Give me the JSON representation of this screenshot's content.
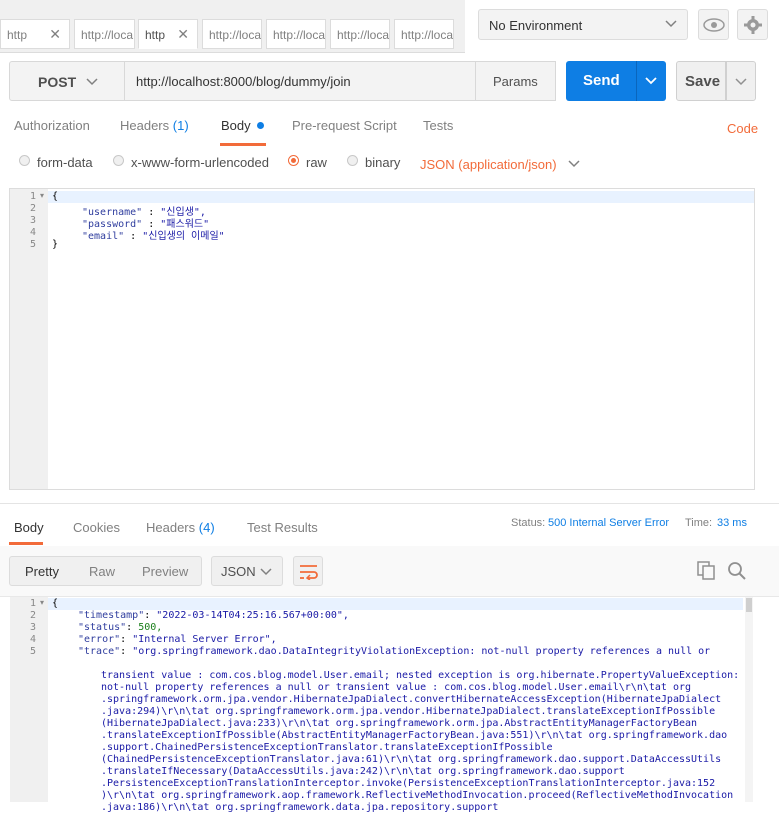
{
  "tabs": [
    {
      "label": "http",
      "active": false,
      "closable": true
    },
    {
      "label": "http://loca",
      "active": false,
      "closable": false
    },
    {
      "label": "http",
      "active": true,
      "closable": true
    },
    {
      "label": "http://loca",
      "active": false,
      "closable": false
    },
    {
      "label": "http://loca",
      "active": false,
      "closable": false
    },
    {
      "label": "http://loca",
      "active": false,
      "closable": false
    },
    {
      "label": "http://loca",
      "active": false,
      "closable": false
    }
  ],
  "environment": {
    "selected": "No Environment"
  },
  "request": {
    "method": "POST",
    "url": "http://localhost:8000/blog/dummy/join",
    "params_label": "Params",
    "send_label": "Send",
    "save_label": "Save"
  },
  "request_tabs": {
    "authorization": "Authorization",
    "headers": "Headers",
    "headers_count": "(1)",
    "body": "Body",
    "prerequest": "Pre-request Script",
    "tests": "Tests",
    "code": "Code"
  },
  "body_types": {
    "form_data": "form-data",
    "urlencoded": "x-www-form-urlencoded",
    "raw": "raw",
    "binary": "binary",
    "selected": "raw",
    "content_type": "JSON (application/json)"
  },
  "request_body": {
    "line_numbers": [
      "1",
      "2",
      "3",
      "4",
      "5"
    ],
    "lines": [
      {
        "key": "",
        "value": "",
        "plain": "{"
      },
      {
        "key": "\"username\"",
        "value": "\"신입생\",",
        "plain": ""
      },
      {
        "key": "\"password\"",
        "value": "\"패스워드\"",
        "plain": ""
      },
      {
        "key": "\"email\"",
        "value": "\"신입생의 이메일\"",
        "plain": ""
      },
      {
        "key": "",
        "value": "",
        "plain": "}"
      }
    ]
  },
  "response_tabs": {
    "body": "Body",
    "cookies": "Cookies",
    "headers": "Headers",
    "headers_count": "(4)",
    "test_results": "Test Results"
  },
  "response_meta": {
    "status_label": "Status:",
    "status_value": "500 Internal Server Error",
    "time_label": "Time:",
    "time_value": "33 ms"
  },
  "response_view": {
    "pretty": "Pretty",
    "raw": "Raw",
    "preview": "Preview",
    "format": "JSON"
  },
  "response_body": {
    "line_numbers": [
      "1",
      "2",
      "3",
      "4",
      "5"
    ],
    "open": "{",
    "timestamp_key": "\"timestamp\"",
    "timestamp_value": "\"2022-03-14T04:25:16.567+00:00\",",
    "status_key": "\"status\"",
    "status_value": "500,",
    "error_key": "\"error\"",
    "error_value": "\"Internal Server Error\",",
    "trace_key": "\"trace\"",
    "trace_first": "\"org.springframework.dao.DataIntegrityViolationException: not-null property references a null or",
    "trace_lines": [
      "transient value : com.cos.blog.model.User.email; nested exception is org.hibernate.PropertyValueException:",
      "not-null property references a null or transient value : com.cos.blog.model.User.email\\r\\n\\tat org",
      ".springframework.orm.jpa.vendor.HibernateJpaDialect.convertHibernateAccessException(HibernateJpaDialect",
      ".java:294)\\r\\n\\tat org.springframework.orm.jpa.vendor.HibernateJpaDialect.translateExceptionIfPossible",
      "(HibernateJpaDialect.java:233)\\r\\n\\tat org.springframework.orm.jpa.AbstractEntityManagerFactoryBean",
      ".translateExceptionIfPossible(AbstractEntityManagerFactoryBean.java:551)\\r\\n\\tat org.springframework.dao",
      ".support.ChainedPersistenceExceptionTranslator.translateExceptionIfPossible",
      "(ChainedPersistenceExceptionTranslator.java:61)\\r\\n\\tat org.springframework.dao.support.DataAccessUtils",
      ".translateIfNecessary(DataAccessUtils.java:242)\\r\\n\\tat org.springframework.dao.support",
      ".PersistenceExceptionTranslationInterceptor.invoke(PersistenceExceptionTranslationInterceptor.java:152",
      ")\\r\\n\\tat org.springframework.aop.framework.ReflectiveMethodInvocation.proceed(ReflectiveMethodInvocation",
      ".java:186)\\r\\n\\tat org.springframework.data.jpa.repository.support"
    ]
  },
  "colors": {
    "accent": "#f26b3a",
    "send": "#0e7ee4",
    "link_blue": "#0e7ee4"
  }
}
